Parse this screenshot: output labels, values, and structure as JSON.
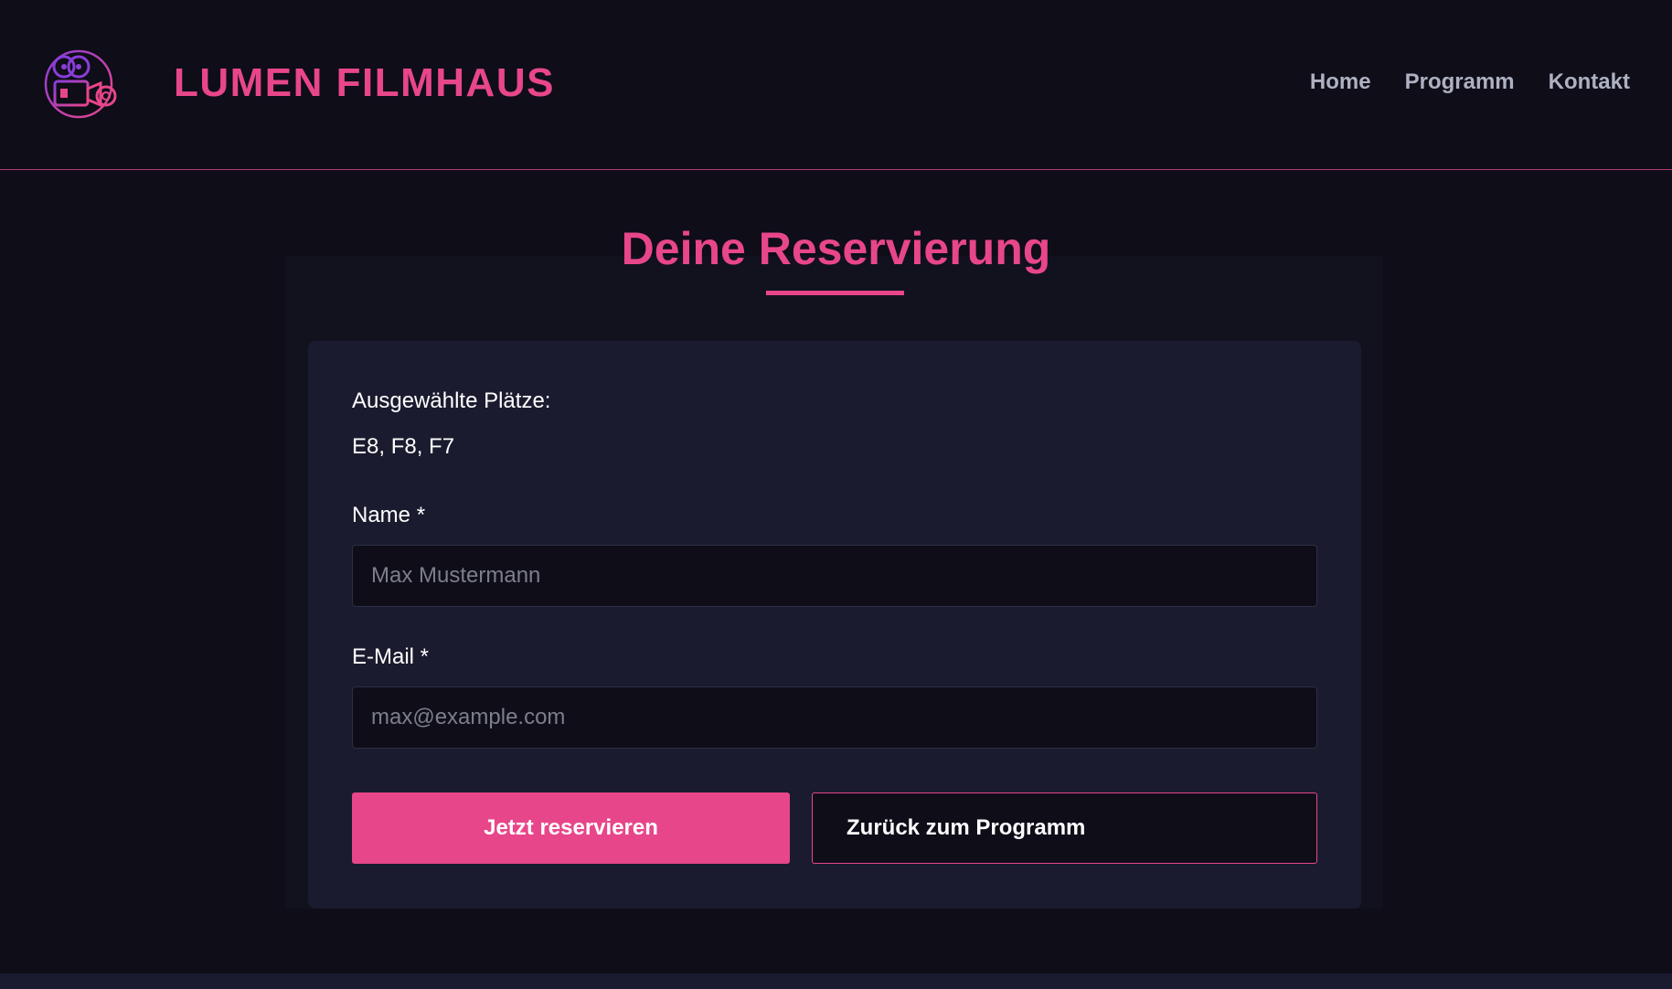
{
  "header": {
    "brand": "LUMEN FILMHAUS",
    "logo_icon": "film-camera-icon",
    "nav": [
      {
        "label": "Home"
      },
      {
        "label": "Programm"
      },
      {
        "label": "Kontakt"
      }
    ]
  },
  "main": {
    "title": "Deine Reservierung",
    "selected_seats_label": "Ausgewählte Plätze:",
    "selected_seats": "E8, F8, F7",
    "name": {
      "label": "Name *",
      "value": "",
      "placeholder": "Max Mustermann"
    },
    "email": {
      "label": "E-Mail *",
      "value": "",
      "placeholder": "max@example.com"
    },
    "submit_label": "Jetzt reservieren",
    "back_label": "Zurück zum Programm"
  },
  "colors": {
    "accent": "#e8468a",
    "background": "#0e0d18",
    "card": "#1a1b2e",
    "nav_text": "#aeb1c2"
  }
}
